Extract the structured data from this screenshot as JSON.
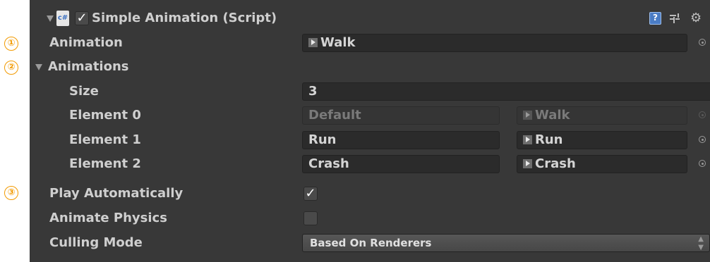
{
  "component": {
    "title": "Simple Animation (Script)",
    "script_icon_text": "c#",
    "enabled_check": "✓"
  },
  "markers": [
    "①",
    "②",
    "③"
  ],
  "animation": {
    "label": "Animation",
    "value": "Walk"
  },
  "animations": {
    "label": "Animations",
    "size_label": "Size",
    "size_value": "3",
    "elements": [
      {
        "label": "Element 0",
        "name": "Default",
        "clip": "Walk",
        "disabled": true
      },
      {
        "label": "Element 1",
        "name": "Run",
        "clip": "Run",
        "disabled": false
      },
      {
        "label": "Element 2",
        "name": "Crash",
        "clip": "Crash",
        "disabled": false
      }
    ]
  },
  "play_automatically": {
    "label": "Play Automatically",
    "checked": true,
    "check_glyph": "✓"
  },
  "animate_physics": {
    "label": "Animate Physics",
    "checked": false
  },
  "culling_mode": {
    "label": "Culling Mode",
    "value": "Based On Renderers"
  },
  "icons": [
    "foldout-arrow-icon",
    "csharp-script-icon",
    "help-icon",
    "preset-icon",
    "gear-icon",
    "object-picker-icon",
    "animation-clip-icon"
  ],
  "colors": {
    "panel": "#383838",
    "marker": "#f29a00",
    "field": "#2b2b2b",
    "help": "#4a7cc4"
  }
}
